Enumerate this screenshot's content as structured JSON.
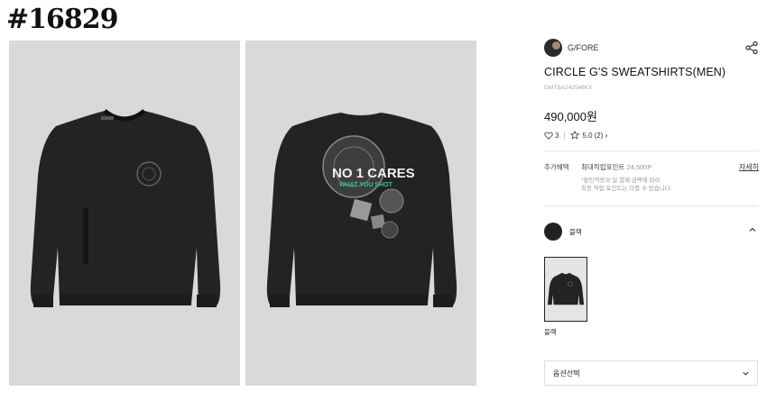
{
  "watermark": "#16829",
  "brand": {
    "name": "G/FORE"
  },
  "product": {
    "title": "CIRCLE G'S SWEATSHIRTS(MEN)",
    "code": "GMTBA242548KX",
    "price": "490,000원",
    "likes": "3",
    "rating": "5.0",
    "reviews": "(2)"
  },
  "benefit": {
    "label": "추가혜택",
    "max_points_label": "최대적립포인트",
    "max_points_value": "24,500P",
    "note_line1": "*할인적용과 실 결제 금액에 따라",
    "note_line2": "최종 적립 포인트는 다를 수 있습니다.",
    "detail_link": "자세히"
  },
  "color": {
    "selected": "블랙",
    "swatch": "#222222",
    "thumb_label": "블랙"
  },
  "option": {
    "label": "옵션선택"
  },
  "artwork": {
    "back_print_line1": "NO 1 CARES",
    "back_print_line2": "WHAT YOU SHOT"
  },
  "icons": {
    "share": "share-icon",
    "heart": "heart-icon",
    "star": "star-icon",
    "chevron_up": "chevron-up-icon",
    "chevron_down": "chevron-down-icon"
  }
}
